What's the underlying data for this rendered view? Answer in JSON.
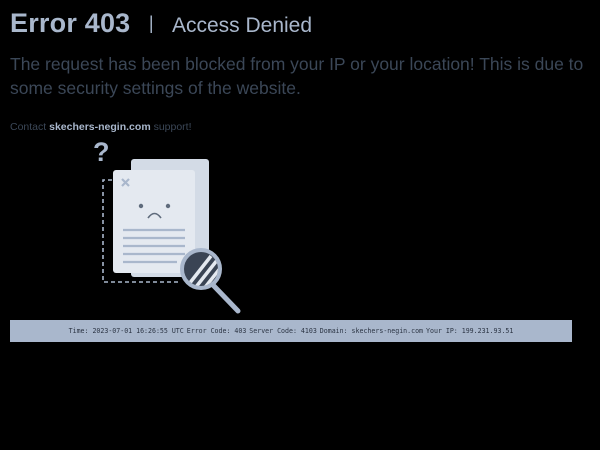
{
  "header": {
    "code": "Error 403",
    "separator": "|",
    "title": "Access Denied"
  },
  "message": "The request has been blocked from your IP or your location! This is due to some security settings of the website.",
  "contact": {
    "prefix": "Contact",
    "domain": "skechers-negin.com",
    "suffix": "support!"
  },
  "illustration": {
    "question_mark": "?",
    "icons": [
      "question-mark-icon",
      "close-icon",
      "sad-face-icon",
      "magnifier-icon",
      "document-icon"
    ]
  },
  "info_bar": {
    "time": "Time: 2023-07-01 16:26:55 UTC",
    "error_code": "Error Code: 403",
    "server_code": "Server Code: 4103",
    "domain": "Domain: skechers-negin.com",
    "ip": "Your IP: 199.231.93.51"
  },
  "colors": {
    "background": "#000000",
    "accent": "#a9b7cc",
    "muted_text": "#3b4757",
    "bar_text": "#2b3443"
  }
}
